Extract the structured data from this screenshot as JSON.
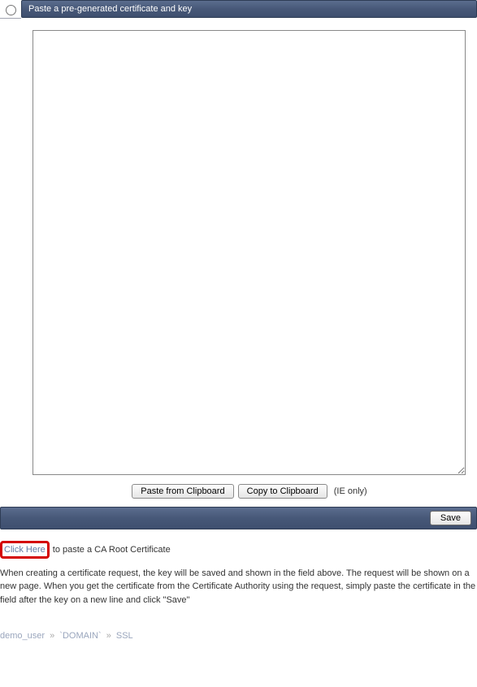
{
  "section": {
    "title": "Paste a pre-generated certificate and key",
    "textarea_value": "",
    "paste_btn": "Paste from Clipboard",
    "copy_btn": "Copy to Clipboard",
    "ie_note": "(IE only)"
  },
  "save_btn": "Save",
  "ca_root": {
    "link": "Click Here",
    "rest": " to paste a CA Root Certificate"
  },
  "help_text": "When creating a certificate request, the key will be saved and shown in the field above. The request will be shown on a new page. When you get the certificate from the Certificate Authority using the request, simply paste the certificate in the field after the key on a new line and click \"Save\"",
  "breadcrumb": {
    "user": "demo_user",
    "domain": "`DOMAIN`",
    "page": "SSL",
    "sep": "»"
  }
}
